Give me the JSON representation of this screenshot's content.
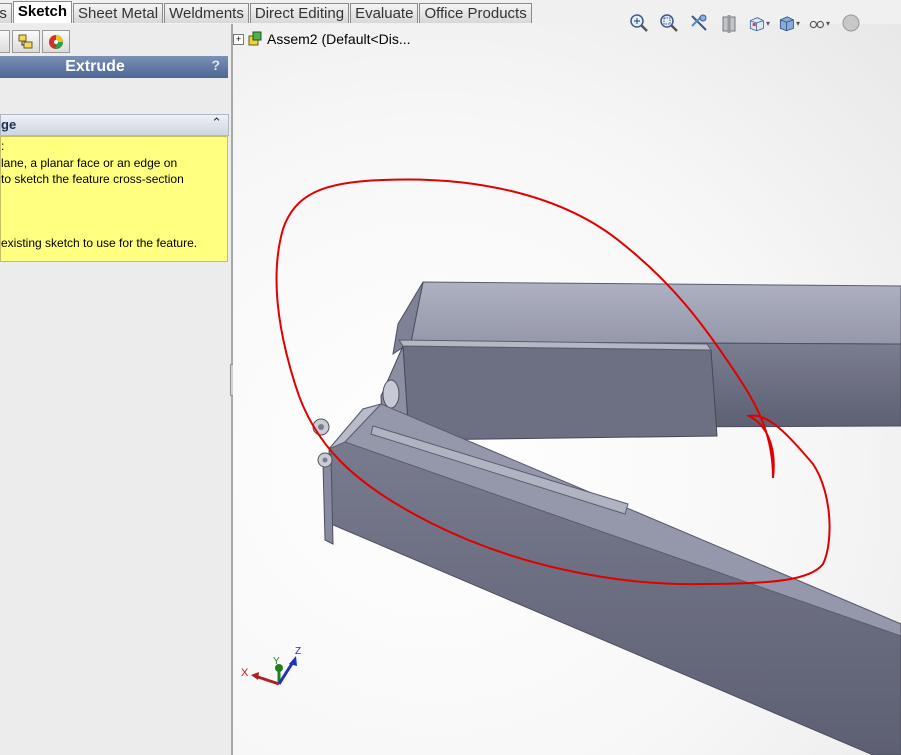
{
  "command_tabs": [
    "es",
    "Sketch",
    "Sheet Metal",
    "Weldments",
    "Direct Editing",
    "Evaluate",
    "Office Products"
  ],
  "active_tab": "Sketch",
  "heads_up_toolbar": [
    "zoom-to-fit-icon",
    "zoom-to-area-icon",
    "previous-view-icon",
    "section-view-icon",
    "view-orientation-icon",
    "display-style-icon",
    "hide-show-items-icon",
    "edit-appearance-icon"
  ],
  "property_manager": {
    "title": "Extrude",
    "help": "?",
    "section_title": "ge",
    "collapse_glyph": "⌃",
    "message": {
      "line1": ":",
      "line2": "lane, a planar face or an edge on",
      "line3": "to sketch the feature cross-section",
      "line4": "existing sketch to use for the feature."
    }
  },
  "feature_tree": {
    "expand": "+",
    "root": "Assem2  (Default<Dis..."
  },
  "triad": {
    "x": "X",
    "y": "Y",
    "z": "Z"
  },
  "annotation_color": "#e00000",
  "part_color": "#8e92a4"
}
